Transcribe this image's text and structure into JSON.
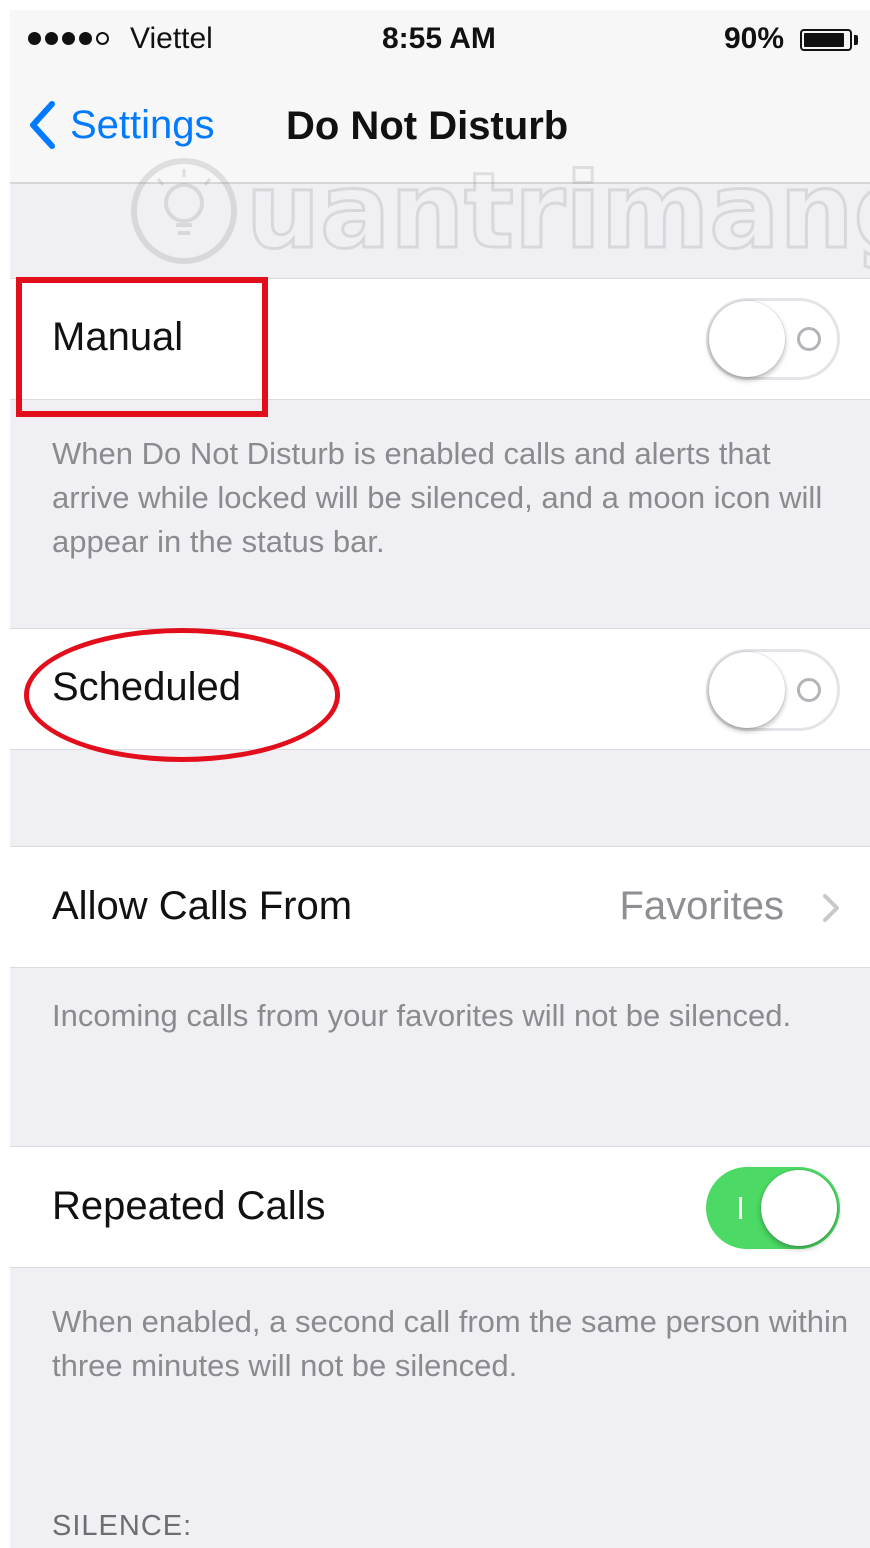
{
  "status_bar": {
    "carrier": "Viettel",
    "time": "8:55 AM",
    "battery_percent": "90%",
    "battery_level": 0.9,
    "signal_bars_filled": 4,
    "signal_bars_total": 5
  },
  "nav": {
    "back_label": "Settings",
    "title": "Do Not Disturb"
  },
  "watermark": {
    "text": "uantrimang"
  },
  "manual": {
    "label": "Manual",
    "enabled": false,
    "footer": "When Do Not Disturb is enabled calls and alerts that arrive while locked will be silenced, and a moon icon will appear in the status bar."
  },
  "scheduled": {
    "label": "Scheduled",
    "enabled": false
  },
  "allow_calls": {
    "label": "Allow Calls From",
    "value": "Favorites",
    "footer": "Incoming calls from your favorites will not be silenced."
  },
  "repeated_calls": {
    "label": "Repeated Calls",
    "enabled": true,
    "footer": "When enabled, a second call from the same person within three minutes will not be silenced."
  },
  "silence": {
    "header": "SILENCE:"
  },
  "colors": {
    "accent": "#007aff",
    "switch_on": "#4cd964",
    "annotation": "#e30e1b",
    "background": "#efeff4"
  }
}
